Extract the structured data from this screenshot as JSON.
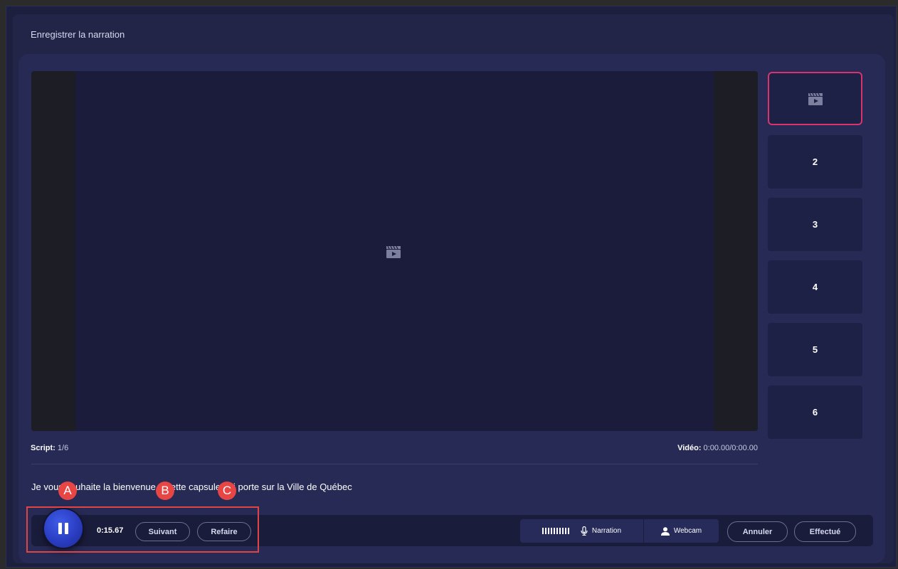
{
  "modal": {
    "title": "Enregistrer la narration"
  },
  "thumbnails": [
    {
      "label": "",
      "icon": "clapperboard-icon",
      "active": true
    },
    {
      "label": "2"
    },
    {
      "label": "3"
    },
    {
      "label": "4"
    },
    {
      "label": "5"
    },
    {
      "label": "6"
    }
  ],
  "info": {
    "script_key": "Script:",
    "script_val": " 1/6",
    "video_key": "Vidéo:",
    "video_val": " 0:00.00/0:00.00"
  },
  "script_text": "Je vous souhaite la bienvenue à cette capsule qui porte sur la Ville de Québec",
  "controls": {
    "timer": "0:15.67",
    "next_label": "Suivant",
    "redo_label": "Refaire",
    "narration_label": "Narration",
    "webcam_label": "Webcam",
    "cancel_label": "Annuler",
    "done_label": "Effectué"
  },
  "annotations": {
    "a": "A",
    "b": "B",
    "c": "C"
  },
  "colors": {
    "accent_border": "#d9336e",
    "record_button": "#2a3dc2",
    "annotation": "#e84545"
  }
}
